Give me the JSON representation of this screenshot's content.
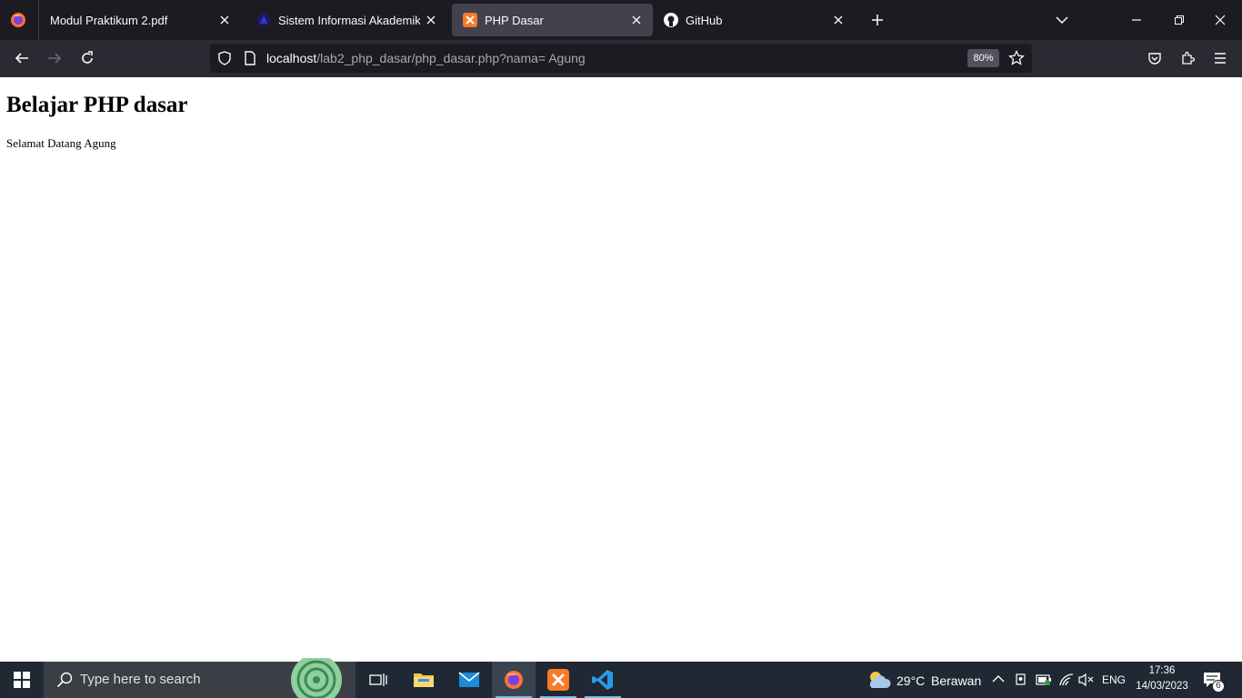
{
  "tabs": [
    {
      "title": "Modul Praktikum 2.pdf",
      "icon": "firefox-pdf-icon",
      "active": false
    },
    {
      "title": "Sistem Informasi Akademik",
      "icon": "university-logo-icon",
      "active": false
    },
    {
      "title": "PHP Dasar",
      "icon": "xampp-icon",
      "active": true
    },
    {
      "title": "GitHub",
      "icon": "github-icon",
      "active": false
    }
  ],
  "navbar": {
    "url_host": "localhost",
    "url_path": "/lab2_php_dasar/php_dasar.php?nama= Agung",
    "zoom": "80%"
  },
  "page": {
    "heading": "Belajar PHP dasar",
    "greeting": "Selamat Datang Agung"
  },
  "taskbar": {
    "search_placeholder": "Type here to search",
    "weather_temp": "29°C",
    "weather_desc": "Berawan",
    "language": "ENG",
    "time": "17:36",
    "date": "14/03/2023",
    "notification_count": "6"
  },
  "colors": {
    "tabstrip_bg": "#1c1b22",
    "toolbar_bg": "#2b2a33",
    "active_tab": "#42414d",
    "taskbar_bg": "#1f2833",
    "accent": "#76b9ed"
  }
}
